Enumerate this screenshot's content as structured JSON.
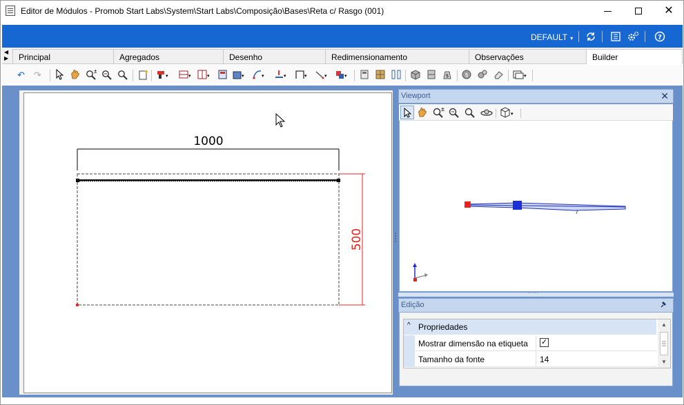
{
  "window": {
    "title": "Editor de Módulos - Promob Start Labs\\System\\Start Labs\\Composição\\Bases\\Reta c/ Rasgo (001)",
    "controls": {
      "minimize": "minimize-icon",
      "maximize": "maximize-icon",
      "close": "✕"
    }
  },
  "header": {
    "profile": "DEFAULT",
    "caret": "▾",
    "icons": [
      "refresh-icon",
      "list-icon",
      "settings-icon",
      "help-icon"
    ]
  },
  "tabs": [
    {
      "label": "Principal"
    },
    {
      "label": "Agregados"
    },
    {
      "label": "Desenho"
    },
    {
      "label": "Redimensionamento"
    },
    {
      "label": "Observações"
    },
    {
      "label": "Builder",
      "active": true
    }
  ],
  "drawing": {
    "width_label": "1000",
    "height_label": "500"
  },
  "viewport": {
    "title": "Viewport",
    "close": "✕"
  },
  "edicao": {
    "title": "Edição",
    "category": "Propriedades",
    "properties": [
      {
        "name": "Mostrar dimensão na etiqueta",
        "value": "",
        "checked": true
      },
      {
        "name": "Tamanho da fonte",
        "value": "14"
      }
    ]
  },
  "colors": {
    "brand_blue": "#1767d3",
    "frame_blue": "#6a90c9",
    "dimension_red": "#e8201e"
  }
}
